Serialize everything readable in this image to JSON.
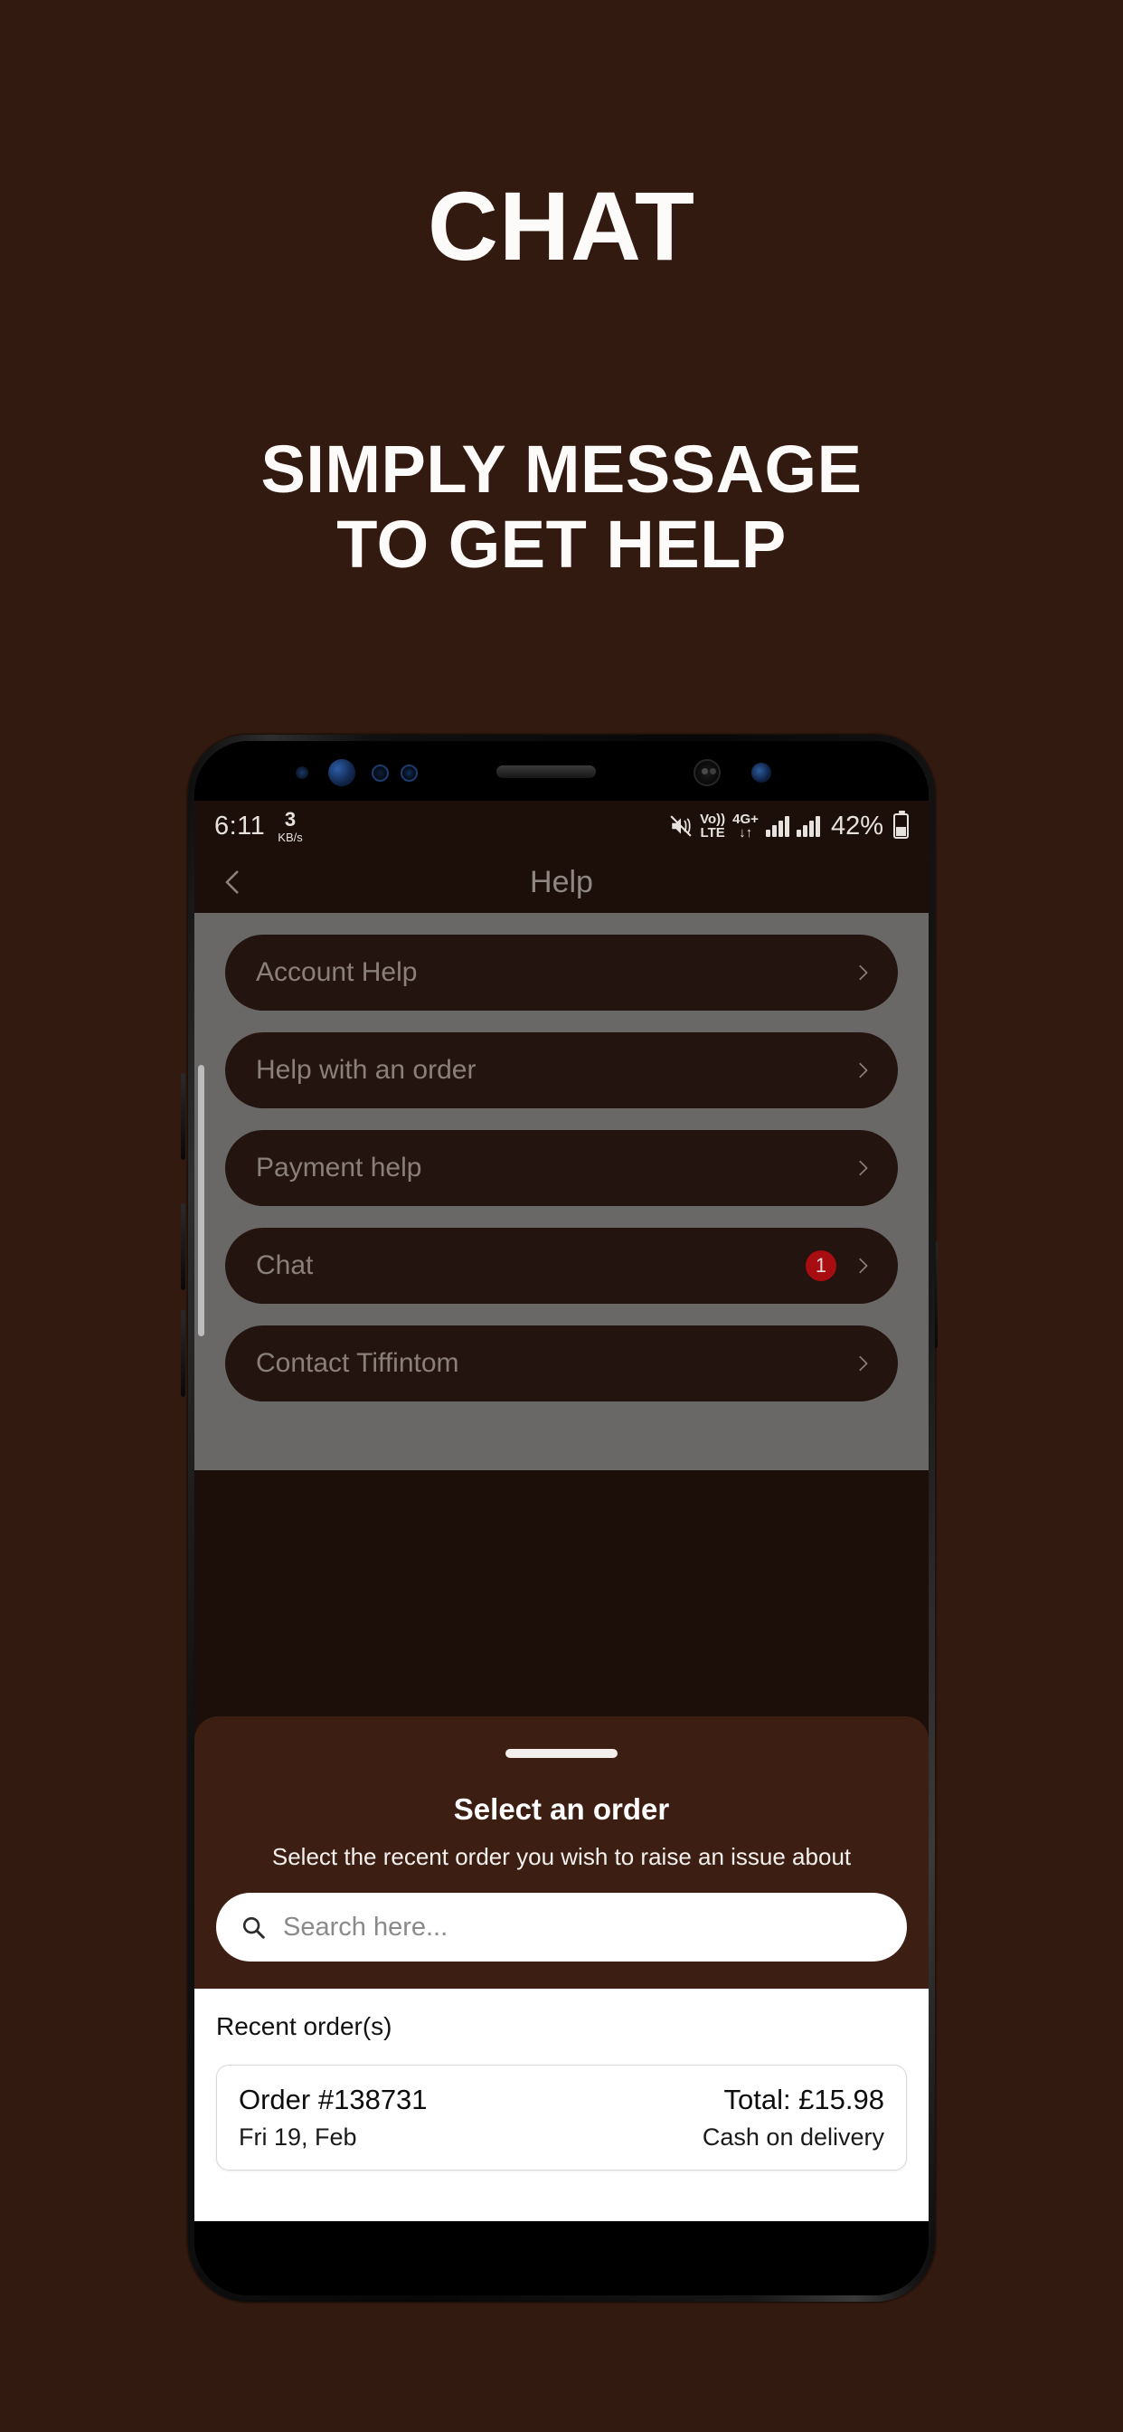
{
  "promo": {
    "title": "CHAT",
    "subtitle_line1": "SIMPLY MESSAGE",
    "subtitle_line2": "TO GET HELP",
    "background_color": "#331A10",
    "text_color": "#FDFBFA"
  },
  "status_bar": {
    "time": "6:11",
    "network_speed_value": "3",
    "network_speed_unit": "KB/s",
    "mute_icon": "mute-icon",
    "volte_line1": "Vo))",
    "volte_line2": "LTE",
    "data_type": "4G+",
    "data_arrows": "↓↑",
    "battery_percent": "42%"
  },
  "app_bar": {
    "back_icon": "back-chevron-icon",
    "title": "Help"
  },
  "help_list": [
    {
      "label": "Account Help",
      "badge": "",
      "chevron": "chevron-right-icon"
    },
    {
      "label": "Help with an order",
      "badge": "",
      "chevron": "chevron-right-icon"
    },
    {
      "label": "Payment help",
      "badge": "",
      "chevron": "chevron-right-icon"
    },
    {
      "label": "Chat",
      "badge": "1",
      "chevron": "chevron-right-icon"
    },
    {
      "label": "Contact Tiffintom",
      "badge": "",
      "chevron": "chevron-right-icon"
    }
  ],
  "badge_color": "#A80D12",
  "sheet": {
    "title": "Select an order",
    "subtitle": "Select the recent order you wish to raise an issue about",
    "search_placeholder": "Search here...",
    "search_value": "",
    "search_icon": "search-icon",
    "orders_header": "Recent order(s)",
    "orders": [
      {
        "order_id": "Order #138731",
        "date": "Fri 19, Feb",
        "total": "Total: £15.98",
        "payment": "Cash on delivery"
      }
    ]
  }
}
